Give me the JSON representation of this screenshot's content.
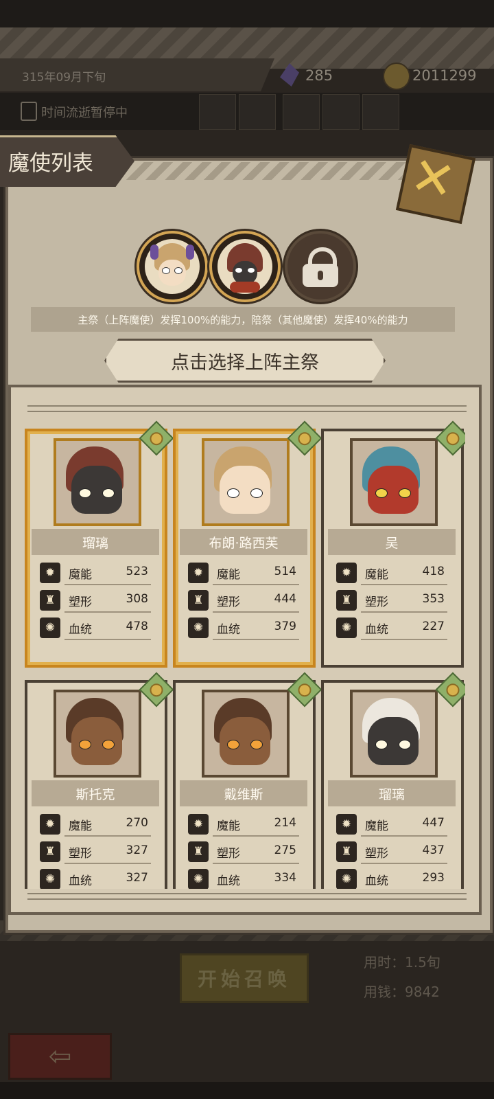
{
  "background": {
    "date": "315年09月下旬",
    "crystals": "285",
    "coins": "2011299",
    "pause_status": "时间流逝暂停中",
    "summon_button": "开始召唤",
    "time_used": "用时：1.5旬",
    "money_used": "用钱：9842",
    "back_arrow": "⇦"
  },
  "panel": {
    "title": "魔使列表",
    "close_glyph": "✕",
    "hint": "主祭（上阵魔使）发挥100%的能力，陪祭（其他魔使）发挥40%的能力",
    "banner": "点击选择上阵主祭",
    "slots": [
      {
        "state": "filled",
        "icon": "horned-girl-portrait"
      },
      {
        "state": "filled",
        "icon": "red-hair-girl-portrait"
      },
      {
        "state": "locked",
        "icon": "padlock-icon"
      }
    ]
  },
  "stat_icons": {
    "mana": "✹",
    "shape": "♜",
    "blood": "✺"
  },
  "cards": [
    {
      "name": "瑠璃",
      "selected": true,
      "hair": "#7a3b2e",
      "skin": "#3c3836",
      "eye": "#fff9e0",
      "stats": [
        {
          "label": "魔能",
          "value": "523"
        },
        {
          "label": "塑形",
          "value": "308"
        },
        {
          "label": "血统",
          "value": "478"
        }
      ]
    },
    {
      "name": "布朗·路西芙",
      "selected": true,
      "hair": "#c9a46e",
      "skin": "#f3ddc3",
      "eye": "#ffffff",
      "stats": [
        {
          "label": "魔能",
          "value": "514"
        },
        {
          "label": "塑形",
          "value": "444"
        },
        {
          "label": "血统",
          "value": "379"
        }
      ]
    },
    {
      "name": "吴",
      "selected": false,
      "hair": "#4e8fa0",
      "skin": "#b23a2c",
      "eye": "#f1d34a",
      "stats": [
        {
          "label": "魔能",
          "value": "418"
        },
        {
          "label": "塑形",
          "value": "353"
        },
        {
          "label": "血统",
          "value": "227"
        }
      ]
    },
    {
      "name": "斯托克",
      "selected": false,
      "hair": "#5a3b28",
      "skin": "#8a5d3c",
      "eye": "#f2a23a",
      "stats": [
        {
          "label": "魔能",
          "value": "270"
        },
        {
          "label": "塑形",
          "value": "327"
        },
        {
          "label": "血统",
          "value": "327"
        }
      ]
    },
    {
      "name": "戴维斯",
      "selected": false,
      "hair": "#5a3b28",
      "skin": "#8a5d3c",
      "eye": "#f2a23a",
      "stats": [
        {
          "label": "魔能",
          "value": "214"
        },
        {
          "label": "塑形",
          "value": "275"
        },
        {
          "label": "血统",
          "value": "334"
        }
      ]
    },
    {
      "name": "瑠璃",
      "selected": false,
      "hair": "#ece7de",
      "skin": "#3c3836",
      "eye": "#fff9e0",
      "stats": [
        {
          "label": "魔能",
          "value": "447"
        },
        {
          "label": "塑形",
          "value": "437"
        },
        {
          "label": "血统",
          "value": "293"
        }
      ]
    }
  ]
}
